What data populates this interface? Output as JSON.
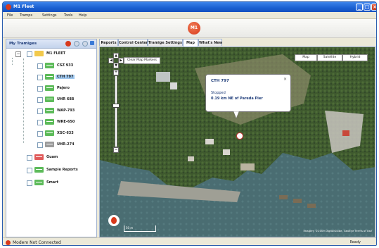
{
  "window": {
    "title": "M1 Fleet"
  },
  "menu": [
    "File",
    "Tramps",
    "Settings",
    "Tools",
    "Help"
  ],
  "banner": {
    "logo_text": "M1"
  },
  "left_panel": {
    "title": "My Tramiges",
    "root": "M1 FLEET",
    "items": [
      {
        "label": "CSZ 933",
        "color": "#5dbb5a",
        "selected": false
      },
      {
        "label": "CTH 797",
        "color": "#5dbb5a",
        "selected": true
      },
      {
        "label": "Pajero",
        "color": "#5dbb5a",
        "selected": false
      },
      {
        "label": "UHR 688",
        "color": "#5dbb5a",
        "selected": false
      },
      {
        "label": "WAP-793",
        "color": "#5dbb5a",
        "selected": false
      },
      {
        "label": "WRE-650",
        "color": "#5dbb5a",
        "selected": false
      },
      {
        "label": "XSC-633",
        "color": "#5dbb5a",
        "selected": false
      },
      {
        "label": "UHR-274",
        "color": "#9a9a9a",
        "selected": false
      }
    ],
    "groups": [
      {
        "label": "Guam",
        "color": "#e05a5a"
      },
      {
        "label": "Sample Reports",
        "color": "#5dbb5a"
      },
      {
        "label": "Smart",
        "color": "#5dbb5a"
      }
    ]
  },
  "tabs": [
    "Reports",
    "Control Center",
    "Tramige Settings",
    "Map",
    "What's New"
  ],
  "active_tab": "Map",
  "map": {
    "clear_markers": "Clear Map Markers",
    "type_buttons": [
      "Map",
      "Satellite",
      "Hybrid"
    ],
    "popup": {
      "title": "CTH 797",
      "status": "Stopped",
      "location": "0.19 km NE of Pareda Pier"
    },
    "copyright": "Imagery ©2009 DigitalGlobe, GeoEye  Terms of Use",
    "scale_label": "50 m"
  },
  "status": {
    "text": "Modem Not Connected",
    "ready": "Ready"
  }
}
